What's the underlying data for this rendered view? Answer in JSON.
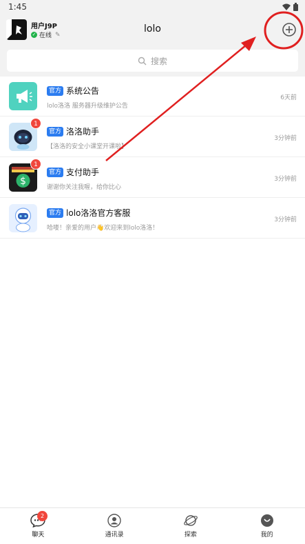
{
  "status_bar": {
    "time": "1:45"
  },
  "header": {
    "user_name": "用户J9P",
    "user_status": "在线",
    "title": "lolo"
  },
  "search": {
    "placeholder": "搜索"
  },
  "tag_label": "官方",
  "chats": [
    {
      "name": "系统公告",
      "preview": "lolo洛洛   服务器升级维护公告",
      "time": "6天前",
      "unread": "",
      "icon": "megaphone-icon"
    },
    {
      "name": "洛洛助手",
      "preview": "【洛洛的安全小课堂开课啦】",
      "time": "3分钟前",
      "unread": "1",
      "icon": "robot-icon"
    },
    {
      "name": "支付助手",
      "preview": "谢谢你关注我喔，给你比心",
      "time": "3分钟前",
      "unread": "1",
      "icon": "wallet-icon"
    },
    {
      "name": "lolo洛洛官方客服",
      "preview": "哈喽！亲爱的用户👋欢迎来到lolo洛洛！",
      "time": "3分钟前",
      "unread": "",
      "icon": "support-bot-icon"
    }
  ],
  "tabs": [
    {
      "label": "聊天",
      "badge": "2",
      "icon": "chat-icon"
    },
    {
      "label": "通讯录",
      "badge": "",
      "icon": "contacts-icon"
    },
    {
      "label": "探索",
      "badge": "",
      "icon": "planet-icon"
    },
    {
      "label": "我的",
      "badge": "",
      "icon": "profile-icon"
    }
  ],
  "colors": {
    "accent": "#2b7cf0",
    "unread_badge": "#f0463c",
    "online": "#21b34a",
    "annotation": "#e02020"
  }
}
